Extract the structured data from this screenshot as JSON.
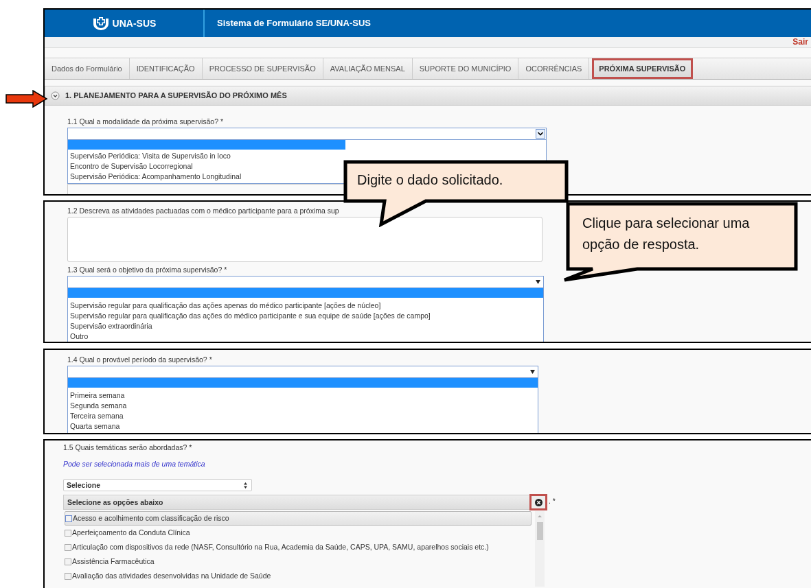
{
  "header": {
    "logo_text": "UNA-SUS",
    "title": "Sistema de Formulário SE/UNA-SUS",
    "logout": "Sair"
  },
  "tabs": [
    {
      "label": "Dados do Formulário",
      "selected": false
    },
    {
      "label": "IDENTIFICAÇÃO",
      "selected": false
    },
    {
      "label": "PROCESSO DE SUPERVISÃO",
      "selected": false
    },
    {
      "label": "AVALIAÇÃO MENSAL",
      "selected": false
    },
    {
      "label": "SUPORTE DO MUNICÍPIO",
      "selected": false
    },
    {
      "label": "OCORRÊNCIAS",
      "selected": false
    },
    {
      "label": "PRÓXIMA SUPERVISÃO",
      "selected": true
    }
  ],
  "section": {
    "title": "1. PLANEJAMENTO PARA A SUPERVISÃO DO PRÓXIMO MÊS",
    "expanded": true
  },
  "panels": [
    {
      "questions": [
        {
          "kind": "dropdown",
          "label": "1.1  Qual a modalidade da próxima supervisão? *",
          "blank_option_highlighted": true,
          "options": [
            {
              "label": "Supervisão Periódica: Visita de Supervisão in loco",
              "selected": false
            },
            {
              "label": "Encontro de Supervisão Locorregional",
              "selected": false
            },
            {
              "label": "Supervisão Periódica: Acompanhamento Longitudinal",
              "selected": false
            }
          ]
        }
      ]
    },
    {
      "questions": [
        {
          "kind": "textarea",
          "label": "1.2  Descreva as atividades pactuadas com o médico participante para a próxima sup"
        },
        {
          "kind": "dropdown",
          "label": "1.3  Qual será o objetivo da próxima supervisão? *",
          "blank_option_highlighted": true,
          "options": [
            {
              "label": "Supervisão regular para qualificação das ações apenas do médico participante [ações de núcleo]",
              "selected": false
            },
            {
              "label": "Supervisão regular para qualificação das ações do médico participante e sua equipe de saúde [ações de campo]",
              "selected": false
            },
            {
              "label": "Supervisão extraordinária",
              "selected": false
            },
            {
              "label": "Outro",
              "selected": false
            }
          ]
        }
      ]
    },
    {
      "questions": [
        {
          "kind": "dropdown",
          "label": "1.4  Qual o provável período da supervisão? *",
          "blank_option_highlighted": true,
          "options": [
            {
              "label": "Primeira semana",
              "selected": false
            },
            {
              "label": "Segunda semana",
              "selected": false
            },
            {
              "label": "Terceira semana",
              "selected": false
            },
            {
              "label": "Quarta semana",
              "selected": false
            }
          ]
        }
      ]
    },
    {
      "questions": [
        {
          "kind": "multiselect",
          "label": "1.5  Quais temáticas serão abordadas? *",
          "hint": "Pode ser selecionada mais de uma temática",
          "select_value": "Selecione",
          "panel_header": "Selecione as opções abaixo",
          "trailing": ". *",
          "close_annotated": true,
          "options": [
            {
              "label": "Acesso e acolhimento com classificação de risco",
              "checked": false,
              "highlighted": true
            },
            {
              "label": "Aperfeiçoamento da Conduta Clínica",
              "checked": false,
              "highlighted": false
            },
            {
              "label": "Articulação com dispositivos da rede (NASF, Consultório na Rua, Academia da Saúde, CAPS, UPA, SAMU, aparelhos sociais etc.)",
              "checked": false,
              "highlighted": false
            },
            {
              "label": "Assistência Farmacêutica",
              "checked": false,
              "highlighted": false
            },
            {
              "label": "Avaliação das atividades desenvolvidas na Unidade de Saúde",
              "checked": false,
              "highlighted": false
            }
          ]
        }
      ]
    }
  ],
  "callouts": [
    {
      "text": "Digite o dado solicitado."
    },
    {
      "text": "Clique para selecionar uma opção de resposta."
    }
  ]
}
